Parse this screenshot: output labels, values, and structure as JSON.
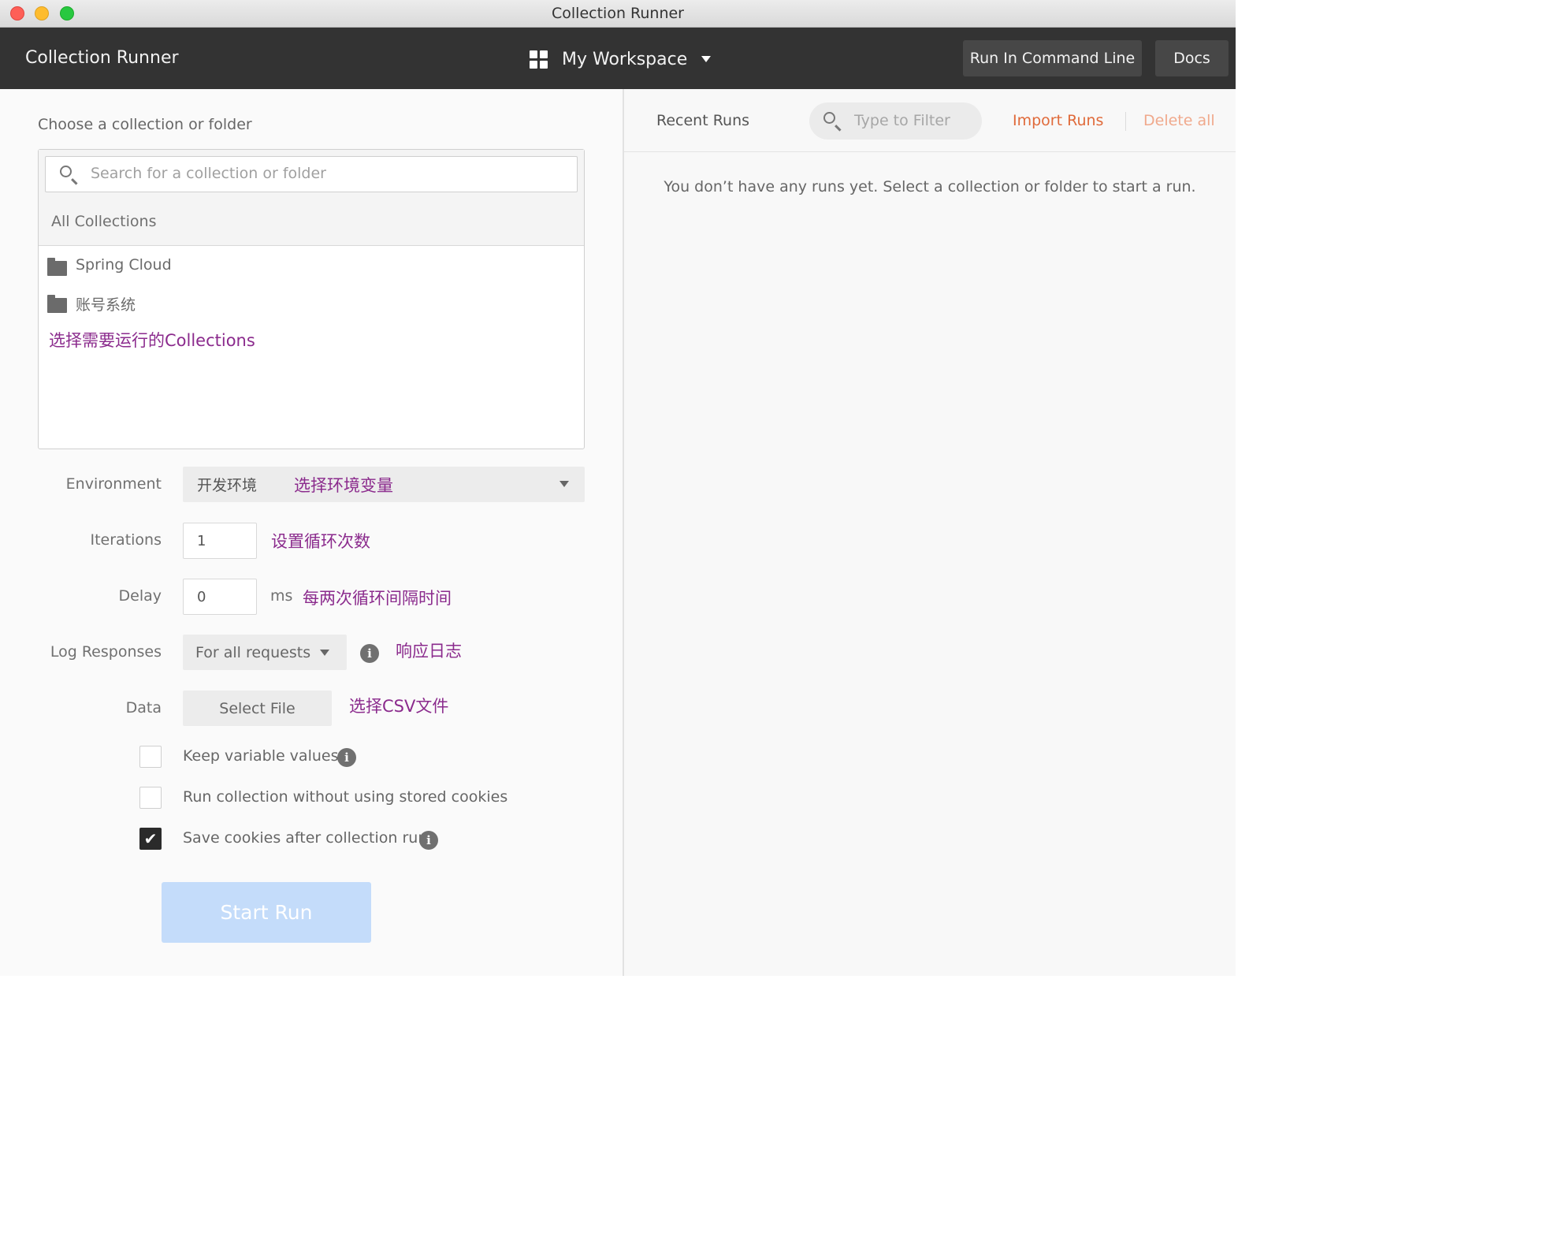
{
  "window": {
    "title": "Collection Runner"
  },
  "header": {
    "app_title": "Collection Runner",
    "workspace": "My Workspace",
    "run_cli_label": "Run In Command Line",
    "docs_label": "Docs"
  },
  "picker": {
    "heading": "Choose a collection or folder",
    "search_placeholder": "Search for a collection or folder",
    "all_collections": "All Collections",
    "items": [
      {
        "label": "Spring Cloud"
      },
      {
        "label": "账号系统"
      }
    ],
    "annotation": "选择需要运行的Collections"
  },
  "form": {
    "environment": {
      "label": "Environment",
      "value": "开发环境",
      "annotation": "选择环境变量"
    },
    "iterations": {
      "label": "Iterations",
      "value": "1",
      "annotation": "设置循环次数"
    },
    "delay": {
      "label": "Delay",
      "value": "0",
      "unit": "ms",
      "annotation": "每两次循环间隔时间"
    },
    "log_responses": {
      "label": "Log Responses",
      "value": "For all requests",
      "annotation": "响应日志"
    },
    "data": {
      "label": "Data",
      "button": "Select File",
      "annotation": "选择CSV文件"
    }
  },
  "options": [
    {
      "label": "Keep variable values",
      "checked": false
    },
    {
      "label": "Run collection without using stored cookies",
      "checked": false
    },
    {
      "label": "Save cookies after collection run",
      "checked": true
    }
  ],
  "start_run_label": "Start Run",
  "runs": {
    "heading": "Recent Runs",
    "filter_placeholder": "Type to Filter",
    "import_label": "Import Runs",
    "delete_label": "Delete all",
    "empty_message": "You don’t have any runs yet. Select a collection or folder to start a run."
  },
  "colors": {
    "header_bg": "#333333",
    "accent_orange": "#e06a3a",
    "annotation_purple": "#8b2b8d",
    "start_button_disabled": "#c4dcfa"
  },
  "icons": [
    "close-light-icon",
    "minimize-light-icon",
    "zoom-light-icon",
    "workspace-grid-icon",
    "chevron-down-icon",
    "search-icon",
    "folder-icon",
    "info-icon",
    "checkmark-icon"
  ]
}
